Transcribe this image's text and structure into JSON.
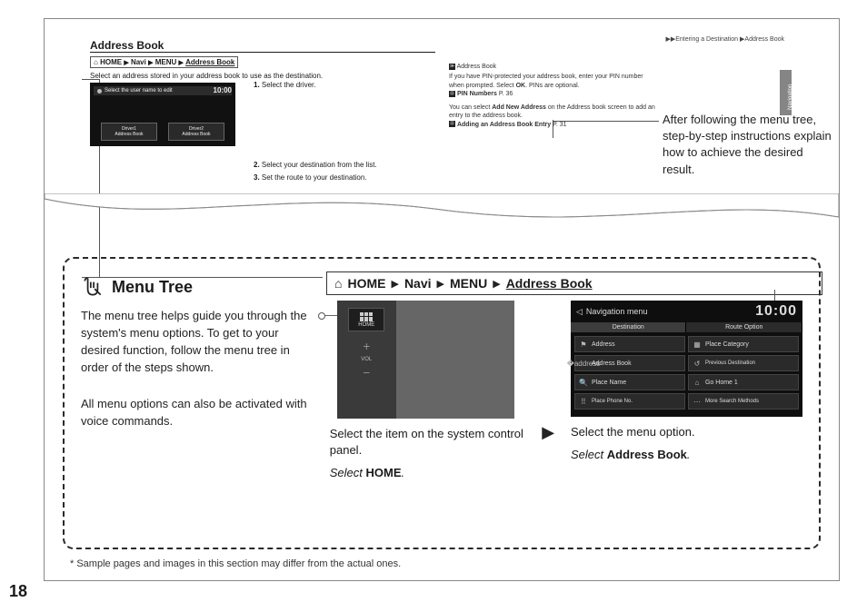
{
  "page_number": "18",
  "footnote": "* Sample pages and images in this section may differ from the actual ones.",
  "upper": {
    "top_breadcrumb": "▶▶Entering a Destination ▶Address Book",
    "section_title": "Address Book",
    "crumb": {
      "home": "HOME",
      "navi": "Navi",
      "menu": "MENU",
      "item": "Address Book"
    },
    "intro": "Select an address stored in your address book to use as the destination.",
    "mini": {
      "title": "Select the user name to edit",
      "time": "10:00",
      "driver1a": "Driver1",
      "driver1b": "Address Book",
      "driver2a": "Driver2",
      "driver2b": "Address Book"
    },
    "steps": {
      "s1n": "1.",
      "s1": "Select the driver.",
      "s2n": "2.",
      "s2": "Select your destination from the list.",
      "s3n": "3.",
      "s3": "Set the route to your destination."
    },
    "sidebar": {
      "title": "Address Book",
      "p1": "If you have PIN-protected your address book, enter your PIN number when prompted. Select",
      "ok": "OK",
      "p1b": ". PINs are optional.",
      "ref1": "PIN Numbers",
      "ref1p": " P. 36",
      "p2a": "You can select ",
      "p2b": "Add New Address",
      "p2c": " on the Address book screen to add an entry to the address book.",
      "ref2": "Adding an Address Book Entry",
      "ref2p": " P. 31",
      "navtab": "Navigation"
    }
  },
  "callout": "After following the menu tree, step-by-step instructions explain how to achieve the desired result.",
  "lower": {
    "heading": "Menu Tree",
    "para1": "The menu tree helps guide you through the system's menu options. To get to your desired function, follow the menu tree in order of the steps shown.",
    "para2": "All menu options can also be activated with voice commands.",
    "crumb": {
      "home": "HOME",
      "navi": "Navi",
      "menu": "MENU",
      "item": "Address Book"
    },
    "panel": {
      "home_label": "HOME",
      "caption": "Select the item on the system control panel.",
      "action_pre": "Select ",
      "action_bold": "HOME",
      "action_post": "."
    },
    "nav": {
      "title": "Navigation menu",
      "clock": "10:00",
      "tab1": "Destination",
      "tab2": "Route Option",
      "c1": "Address",
      "c2": "Place Category",
      "c3": "Address Book",
      "c4": "Previous Destination",
      "c5": "Place Name",
      "c6": "Go Home 1",
      "c7": "Place Phone No.",
      "c8": "More Search Methods",
      "caption": "Select the menu option.",
      "action_pre": "Select ",
      "action_bold": "Address Book",
      "action_post": "."
    }
  }
}
